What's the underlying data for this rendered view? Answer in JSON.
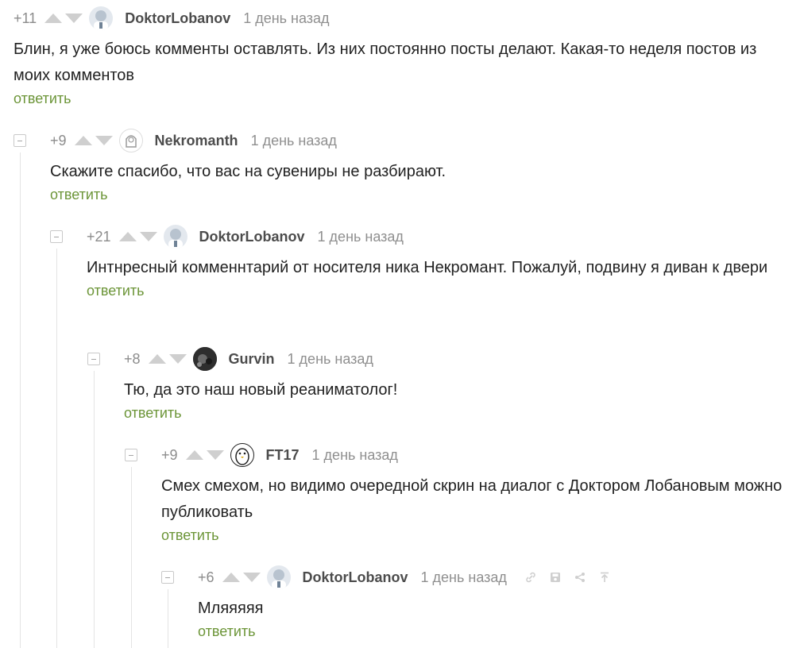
{
  "reply_label": "ответить",
  "comments": [
    {
      "rating": "+11",
      "author": "DoktorLobanov",
      "time": "1 день назад",
      "text": "Блин, я уже боюсь комменты оставлять. Из них постоянно посты делают. Какая-то неделя постов из моих комментов"
    },
    {
      "rating": "+9",
      "author": "Nekromanth",
      "time": "1 день назад",
      "text": "Скажите спасибо, что вас на сувениры не разбирают."
    },
    {
      "rating": "+21",
      "author": "DoktorLobanov",
      "time": "1 день назад",
      "text": "Интнресный комменнтарий от носителя ника Некромант. Пожалуй, подвину я диван к двери"
    },
    {
      "rating": "+8",
      "author": "Gurvin",
      "time": "1 день назад",
      "text": "Тю, да это наш новый реаниматолог!"
    },
    {
      "rating": "+9",
      "author": "FT17",
      "time": "1 день назад",
      "text": "Смех смехом, но видимо очередной скрин на диалог с Доктором Лобановым можно публиковать"
    },
    {
      "rating": "+6",
      "author": "DoktorLobanov",
      "time": "1 день назад",
      "text": "Мляяяяя"
    }
  ],
  "colors": {
    "reply_link": "#6c9538",
    "rating": "#8c8c8c",
    "author": "#4c4c4c",
    "time": "#8f8f8f",
    "vote_arrow": "#cfcfcf",
    "thread_line": "#e4e4e4"
  },
  "icons": [
    "collapse-icon",
    "vote-up-icon",
    "vote-down-icon",
    "link-icon",
    "save-icon",
    "share-icon",
    "upload-icon"
  ]
}
